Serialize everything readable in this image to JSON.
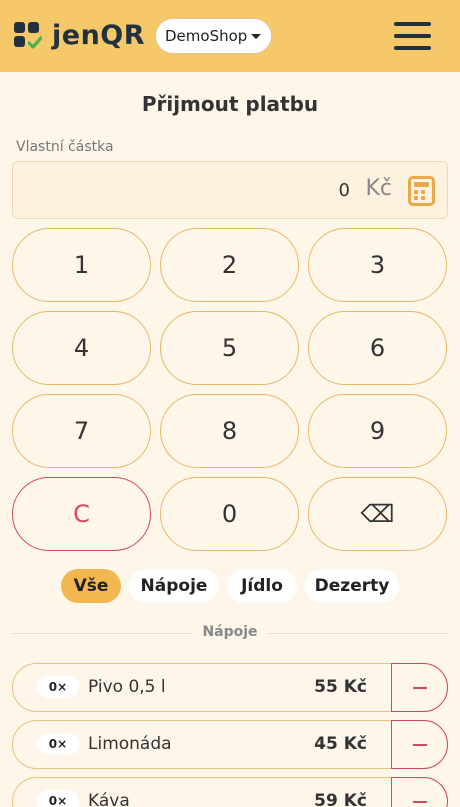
{
  "header": {
    "logo_text": "jenQR",
    "shop_select": "DemoShop",
    "colors": {
      "bar": "#f5c86a",
      "logo_squares": "#21313e",
      "logo_check": "#4caf50"
    }
  },
  "page": {
    "title": "Přijmout platbu",
    "amount_label": "Vlastní částka",
    "amount_value": "0",
    "currency": "Kč"
  },
  "keypad": [
    {
      "label": "1",
      "name": "key-1"
    },
    {
      "label": "2",
      "name": "key-2"
    },
    {
      "label": "3",
      "name": "key-3"
    },
    {
      "label": "4",
      "name": "key-4"
    },
    {
      "label": "5",
      "name": "key-5"
    },
    {
      "label": "6",
      "name": "key-6"
    },
    {
      "label": "7",
      "name": "key-7"
    },
    {
      "label": "8",
      "name": "key-8"
    },
    {
      "label": "9",
      "name": "key-9"
    },
    {
      "label": "C",
      "name": "key-clear"
    },
    {
      "label": "0",
      "name": "key-0"
    },
    {
      "label": "⌫",
      "name": "key-backspace"
    }
  ],
  "filters": [
    {
      "label": "Vše",
      "active": true
    },
    {
      "label": "Nápoje",
      "active": false
    },
    {
      "label": "Jídlo",
      "active": false
    },
    {
      "label": "Dezerty",
      "active": false
    }
  ],
  "section": {
    "label": "Nápoje"
  },
  "products": [
    {
      "qty": "0×",
      "name": "Pivo 0,5 l",
      "price": "55 Kč"
    },
    {
      "qty": "0×",
      "name": "Limonáda",
      "price": "45 Kč"
    },
    {
      "qty": "0×",
      "name": "Káva",
      "price": "59 Kč"
    }
  ],
  "icons": {
    "menu": "hamburger-icon",
    "calculator": "calculator-icon",
    "minus": "minus-icon"
  }
}
